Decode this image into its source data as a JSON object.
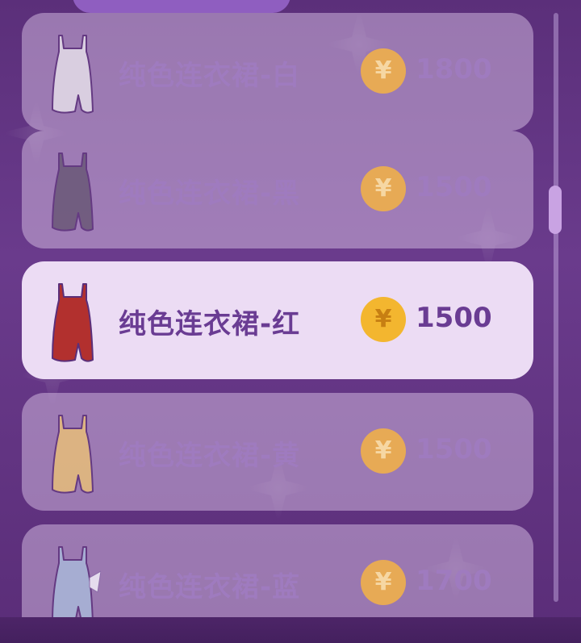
{
  "colors": {
    "background": "#5b2f7a",
    "item_bg": "#c7acd9",
    "item_selected_bg": "#ecdcf4",
    "text_muted": "#9f7bbf",
    "text_selected": "#6a3c93",
    "coin": "#f3b62f"
  },
  "currency_symbol": "¥",
  "items": [
    {
      "name": "纯色连衣裙-白",
      "price": "1800",
      "dress_color": "#e4dde9",
      "selected": false
    },
    {
      "name": "纯色连衣裙-黑",
      "price": "1500",
      "dress_color": "#6a5877",
      "selected": false
    },
    {
      "name": "纯色连衣裙-红",
      "price": "1500",
      "dress_color": "#b2302e",
      "selected": true
    },
    {
      "name": "纯色连衣裙-黄",
      "price": "1500",
      "dress_color": "#e7bd7a",
      "selected": false
    },
    {
      "name": "纯色连衣裙-蓝",
      "price": "1700",
      "dress_color": "#a9b7d8",
      "selected": false
    }
  ]
}
